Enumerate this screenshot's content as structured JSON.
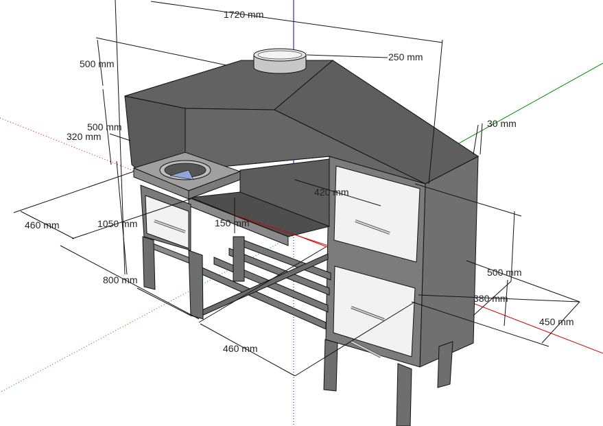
{
  "viewport": {
    "background": "#ffffff"
  },
  "axes": {
    "red": "#d40000",
    "green": "#008800",
    "blue": "#0000cc"
  },
  "colors": {
    "steel_dark": "#595959",
    "steel_mid": "#7a7a7a",
    "steel_light": "#a8a8a8",
    "door_face": "#f2f2f2",
    "outline": "#111111"
  },
  "dimensions": {
    "hood_width": "1720 mm",
    "flue_diameter": "250 mm",
    "hood_height": "500 mm",
    "hood_lower": "500 mm",
    "hood_lip": "320 mm",
    "wall_thickness": "30 mm",
    "cabinet_width": "420 mm",
    "left_depth": "460 mm",
    "overall_height": "1050 mm",
    "tray_height": "150 mm",
    "leg_height": "800 mm",
    "bottom_depth": "460 mm",
    "right_height": "500 mm",
    "right_inner": "380 mm",
    "right_depth": "450 mm"
  }
}
